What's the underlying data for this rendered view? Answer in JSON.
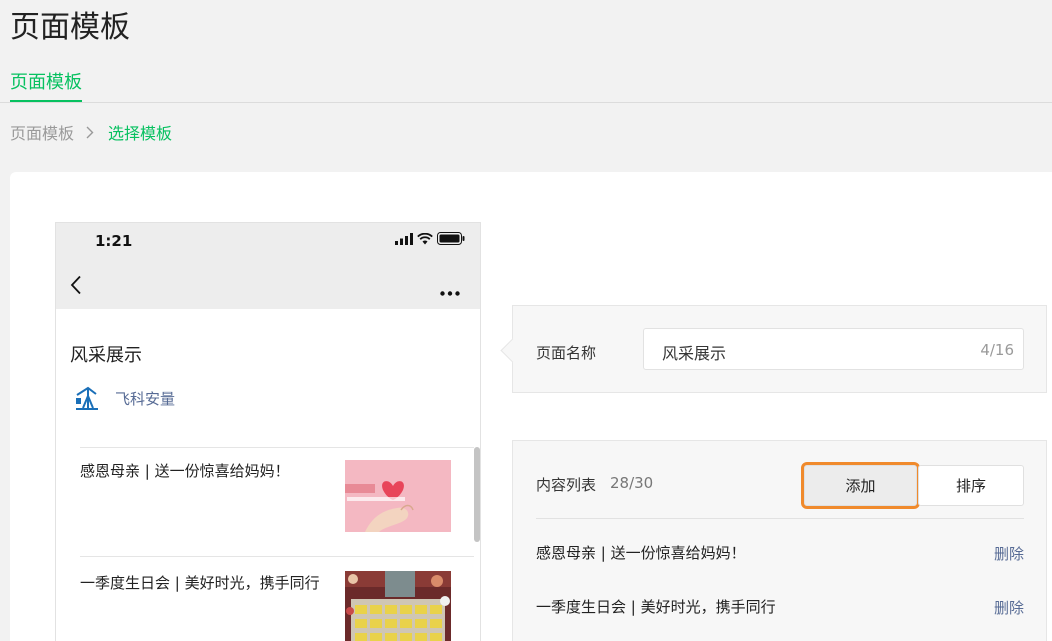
{
  "header": {
    "title": "页面模板"
  },
  "tabs": [
    {
      "label": "页面模板",
      "active": true
    }
  ],
  "breadcrumb": {
    "home": "页面模板",
    "current": "选择模板"
  },
  "preview": {
    "time": "1:21",
    "article_title": "风采展示",
    "account_name": "飞科安量",
    "items": [
      {
        "title": "感恩母亲 | 送一份惊喜给妈妈！"
      },
      {
        "title": "一季度生日会 | 美好时光，携手同行"
      }
    ]
  },
  "page_name": {
    "label": "页面名称",
    "value": "风采展示",
    "count": "4/16"
  },
  "content_list": {
    "label": "内容列表",
    "count": "28/30",
    "add_label": "添加",
    "sort_label": "排序",
    "delete_label": "删除",
    "items": [
      {
        "title": "感恩母亲 | 送一份惊喜给妈妈！"
      },
      {
        "title": "一季度生日会 | 美好时光，携手同行"
      }
    ]
  },
  "colors": {
    "accent": "#07c160",
    "link": "#576b95",
    "highlight": "#f08a2c"
  }
}
